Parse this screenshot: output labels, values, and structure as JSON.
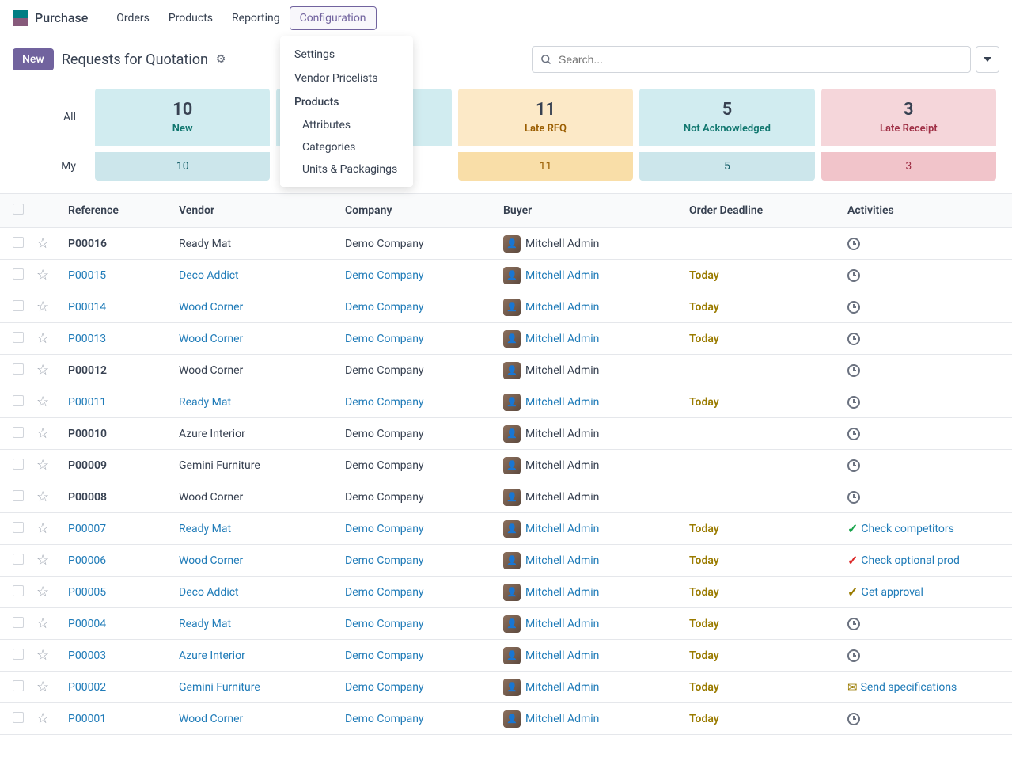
{
  "nav": {
    "app": "Purchase",
    "items": [
      "Orders",
      "Products",
      "Reporting",
      "Configuration"
    ]
  },
  "breadcrumb": {
    "new_btn": "New",
    "title": "Requests for Quotation"
  },
  "search": {
    "placeholder": "Search..."
  },
  "dropdown": {
    "settings": "Settings",
    "vendor_pricelists": "Vendor Pricelists",
    "products_header": "Products",
    "attributes": "Attributes",
    "categories": "Categories",
    "units": "Units & Packagings"
  },
  "stats": {
    "all_label": "All",
    "my_label": "My",
    "cards": [
      {
        "num": "10",
        "title": "New",
        "my": "10",
        "cls": "new"
      },
      {
        "num": "",
        "title": "",
        "my": "",
        "cls": "new2"
      },
      {
        "num": "11",
        "title": "Late RFQ",
        "my": "11",
        "cls": "late-rfq"
      },
      {
        "num": "5",
        "title": "Not Acknowledged",
        "my": "5",
        "cls": "not-ack"
      },
      {
        "num": "3",
        "title": "Late Receipt",
        "my": "3",
        "cls": "late-receipt"
      }
    ]
  },
  "columns": {
    "reference": "Reference",
    "vendor": "Vendor",
    "company": "Company",
    "buyer": "Buyer",
    "deadline": "Order Deadline",
    "activities": "Activities"
  },
  "rows": [
    {
      "ref": "P00016",
      "vendor": "Ready Mat",
      "company": "Demo Company",
      "buyer": "Mitchell Admin",
      "deadline": "",
      "activity": "clock",
      "link": false
    },
    {
      "ref": "P00015",
      "vendor": "Deco Addict",
      "company": "Demo Company",
      "buyer": "Mitchell Admin",
      "deadline": "Today",
      "activity": "clock",
      "link": true
    },
    {
      "ref": "P00014",
      "vendor": "Wood Corner",
      "company": "Demo Company",
      "buyer": "Mitchell Admin",
      "deadline": "Today",
      "activity": "clock",
      "link": true
    },
    {
      "ref": "P00013",
      "vendor": "Wood Corner",
      "company": "Demo Company",
      "buyer": "Mitchell Admin",
      "deadline": "Today",
      "activity": "clock",
      "link": true
    },
    {
      "ref": "P00012",
      "vendor": "Wood Corner",
      "company": "Demo Company",
      "buyer": "Mitchell Admin",
      "deadline": "",
      "activity": "clock",
      "link": false
    },
    {
      "ref": "P00011",
      "vendor": "Ready Mat",
      "company": "Demo Company",
      "buyer": "Mitchell Admin",
      "deadline": "Today",
      "activity": "clock",
      "link": true
    },
    {
      "ref": "P00010",
      "vendor": "Azure Interior",
      "company": "Demo Company",
      "buyer": "Mitchell Admin",
      "deadline": "",
      "activity": "clock",
      "link": false
    },
    {
      "ref": "P00009",
      "vendor": "Gemini Furniture",
      "company": "Demo Company",
      "buyer": "Mitchell Admin",
      "deadline": "",
      "activity": "clock",
      "link": false
    },
    {
      "ref": "P00008",
      "vendor": "Wood Corner",
      "company": "Demo Company",
      "buyer": "Mitchell Admin",
      "deadline": "",
      "activity": "clock",
      "link": false
    },
    {
      "ref": "P00007",
      "vendor": "Ready Mat",
      "company": "Demo Company",
      "buyer": "Mitchell Admin",
      "deadline": "Today",
      "activity": "check-green",
      "activity_text": "Check competitors",
      "link": true
    },
    {
      "ref": "P00006",
      "vendor": "Wood Corner",
      "company": "Demo Company",
      "buyer": "Mitchell Admin",
      "deadline": "Today",
      "activity": "check-red",
      "activity_text": "Check optional prod",
      "link": true
    },
    {
      "ref": "P00005",
      "vendor": "Deco Addict",
      "company": "Demo Company",
      "buyer": "Mitchell Admin",
      "deadline": "Today",
      "activity": "check-brown",
      "activity_text": "Get approval",
      "link": true
    },
    {
      "ref": "P00004",
      "vendor": "Ready Mat",
      "company": "Demo Company",
      "buyer": "Mitchell Admin",
      "deadline": "Today",
      "activity": "clock",
      "link": true
    },
    {
      "ref": "P00003",
      "vendor": "Azure Interior",
      "company": "Demo Company",
      "buyer": "Mitchell Admin",
      "deadline": "Today",
      "activity": "clock",
      "link": true
    },
    {
      "ref": "P00002",
      "vendor": "Gemini Furniture",
      "company": "Demo Company",
      "buyer": "Mitchell Admin",
      "deadline": "Today",
      "activity": "envelope",
      "activity_text": "Send specifications",
      "link": true
    },
    {
      "ref": "P00001",
      "vendor": "Wood Corner",
      "company": "Demo Company",
      "buyer": "Mitchell Admin",
      "deadline": "Today",
      "activity": "clock",
      "link": true
    }
  ]
}
